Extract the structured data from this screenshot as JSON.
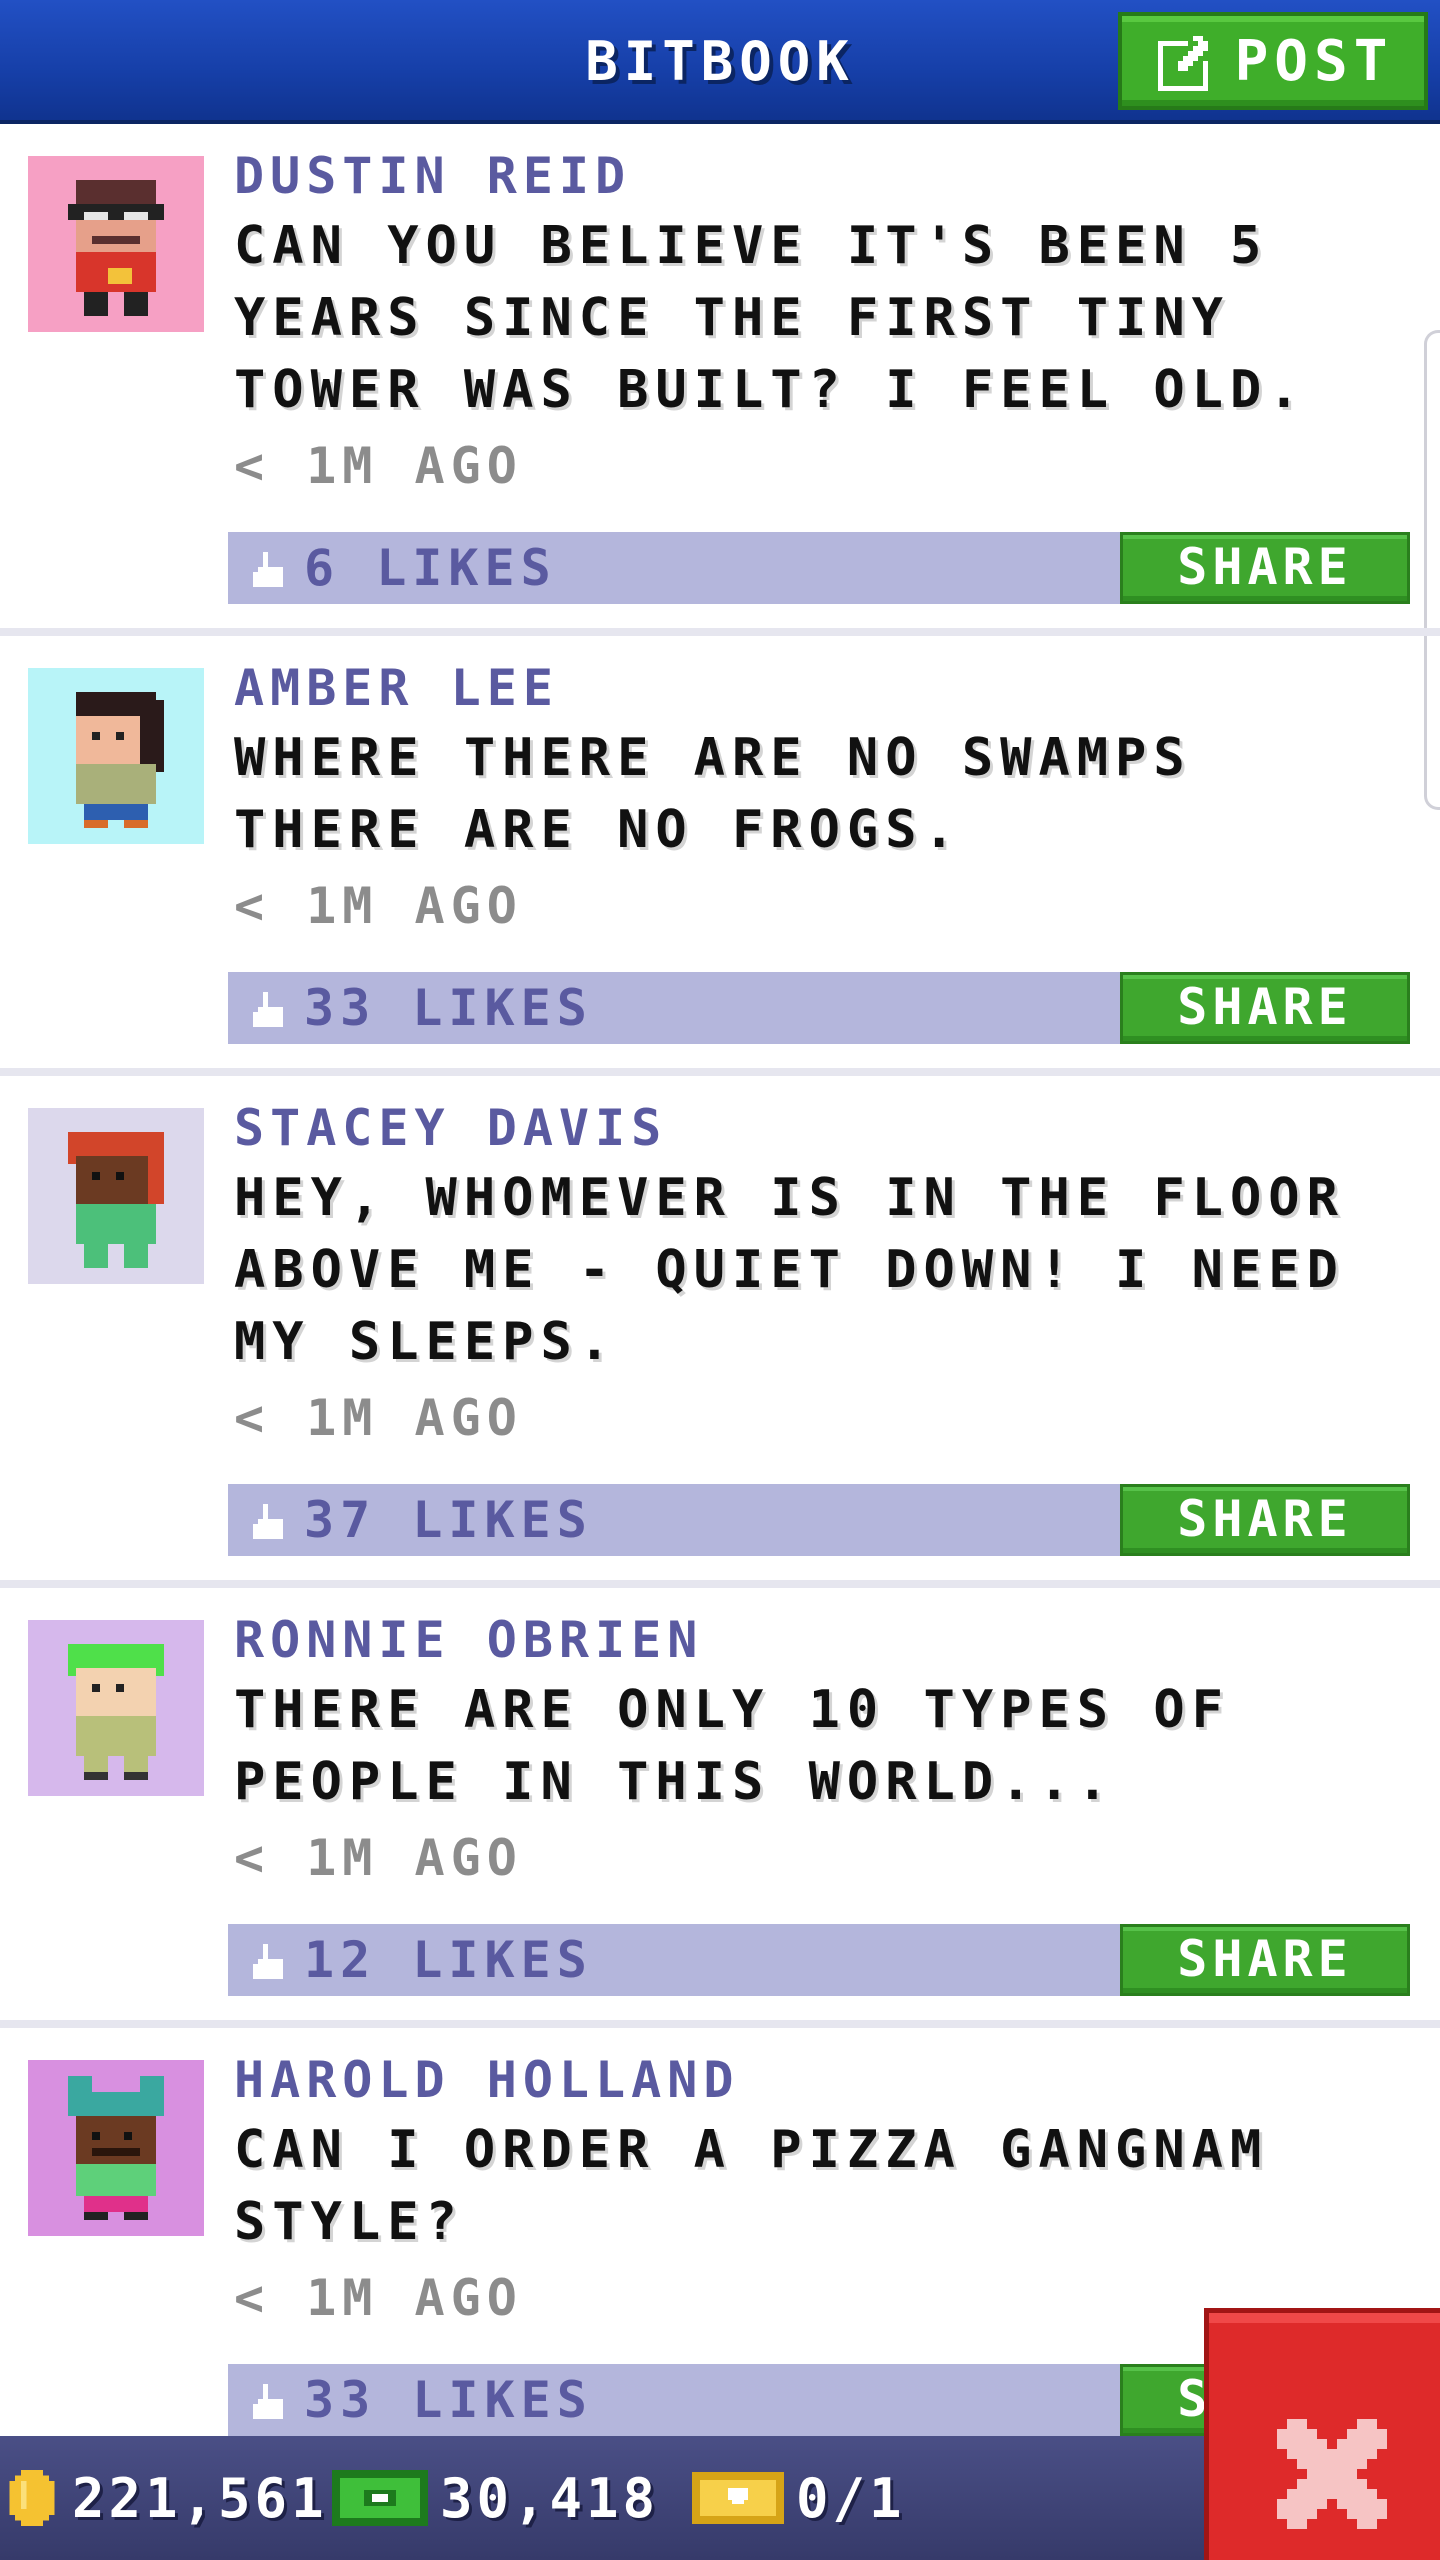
{
  "header": {
    "title": "BITBOOK",
    "post_label": "POST"
  },
  "colors": {
    "header_blue": "#1a47b8",
    "name_purple": "#5a5aa0",
    "likes_bar": "#b4b6dc",
    "share_green": "#3fa72e",
    "close_red": "#de2a2a"
  },
  "posts": [
    {
      "name": "DUSTIN REID",
      "text": "CAN YOU BELIEVE IT'S BEEN 5 YEARS SINCE THE FIRST TINY TOWER WAS BUILT? I FEEL OLD.",
      "time": "< 1M AGO",
      "likes": "6 LIKES",
      "share": "SHARE",
      "avatar_bg": "#f6a0c4"
    },
    {
      "name": "AMBER LEE",
      "text": "WHERE THERE ARE NO SWAMPS THERE ARE NO FROGS.",
      "time": "< 1M AGO",
      "likes": "33 LIKES",
      "share": "SHARE",
      "avatar_bg": "#b8f4f8"
    },
    {
      "name": "STACEY DAVIS",
      "text": "HEY, WHOMEVER IS IN THE FLOOR ABOVE ME - QUIET DOWN! I NEED MY SLEEPS.",
      "time": "< 1M AGO",
      "likes": "37 LIKES",
      "share": "SHARE",
      "avatar_bg": "#dcd8ec"
    },
    {
      "name": "RONNIE OBRIEN",
      "text": "THERE ARE ONLY 10 TYPES OF PEOPLE IN THIS WORLD...",
      "time": "< 1M AGO",
      "likes": "12 LIKES",
      "share": "SHARE",
      "avatar_bg": "#d6b8ec"
    },
    {
      "name": "HAROLD HOLLAND",
      "text": "CAN I ORDER A PIZZA GANGNAM STYLE?",
      "time": "< 1M AGO",
      "likes": "33 LIKES",
      "share": "SHARE",
      "avatar_bg": "#d890e0"
    }
  ],
  "status": {
    "coins": "221,561",
    "bux": "30,418",
    "tickets": "0/1"
  },
  "icons": {
    "post": "edit-icon",
    "likes": "thumbs-up-icon",
    "coins": "coin-icon",
    "bux": "bux-icon",
    "tickets": "ticket-icon",
    "close": "close-icon"
  }
}
